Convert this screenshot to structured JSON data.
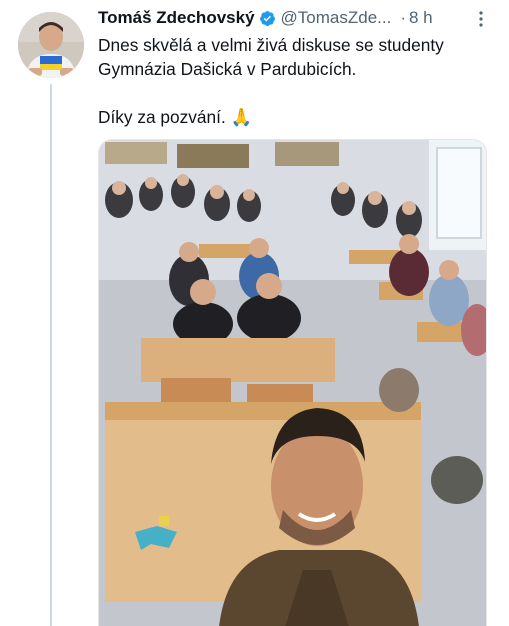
{
  "tweet": {
    "author_name": "Tomáš Zdechovský",
    "handle": "@TomasZde...",
    "separator": "·",
    "time": "8 h",
    "verified": true,
    "text": "Dnes skvělá a velmi živá diskuse se studenty Gymnázia Dašická v Pardubicích.\n\nDíky za pozvání. 🙏",
    "media_description_icon": "photo",
    "icons": [
      "verified-icon",
      "more-icon"
    ]
  },
  "colors": {
    "verified": "#1d9bf0",
    "muted_text": "#536471",
    "thread_line": "#cfd9de"
  }
}
